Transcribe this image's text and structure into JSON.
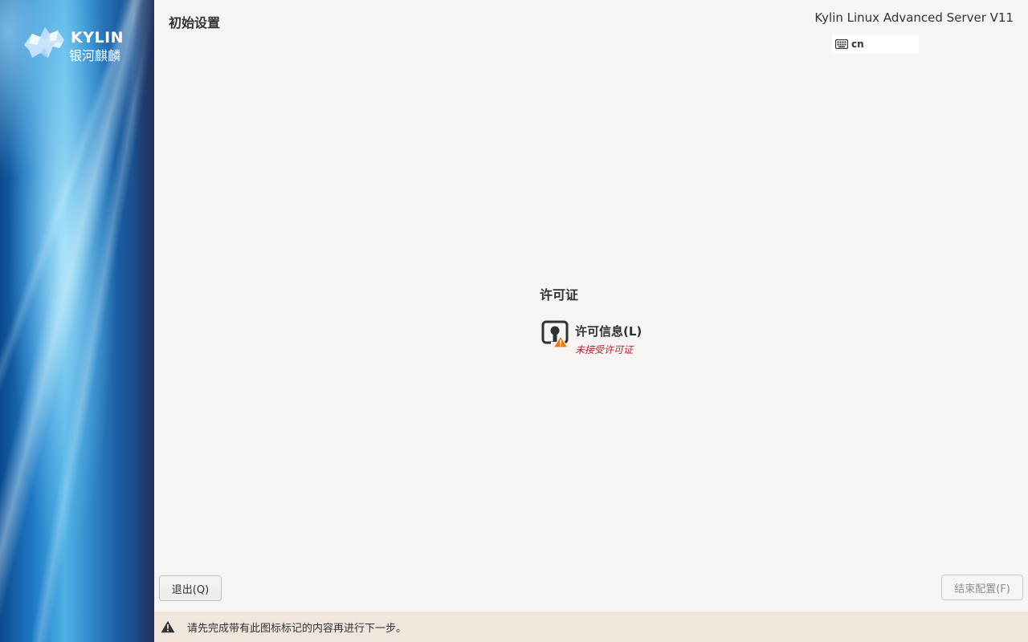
{
  "header": {
    "title": "初始设置",
    "product": "Kylin Linux Advanced Server V11",
    "keyboard_layout": "cn"
  },
  "brand": {
    "logo_en": "KYLIN",
    "logo_cn": "银河麒麟"
  },
  "hub": {
    "section_title": "许可证",
    "spokes": [
      {
        "title": "许可信息(L)",
        "status": "未接受许可证",
        "icon": "license-warning-icon"
      }
    ]
  },
  "footer": {
    "quit_label": "退出(Q)",
    "finish_label": "结束配置(F)",
    "finish_enabled": false
  },
  "warning": {
    "icon": "warning-icon",
    "text": "请先完成带有此图标标记的内容再进行下一步。"
  },
  "colors": {
    "background": "#f6f5f4",
    "status_error": "#c01c28",
    "warning_bar": "#f1e6dc",
    "warning_badge": "#f57900",
    "text": "#2e3436"
  }
}
